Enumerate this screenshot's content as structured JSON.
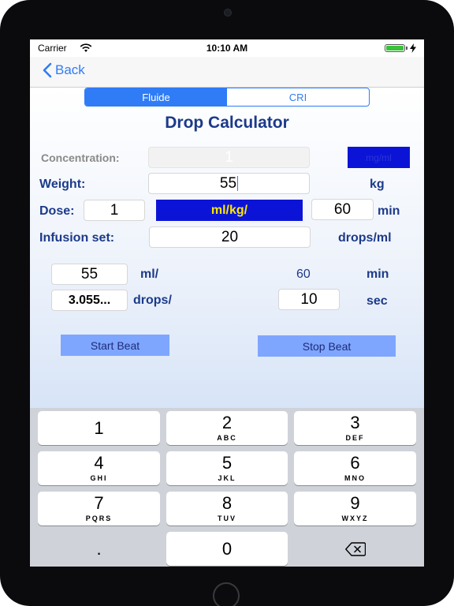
{
  "status_bar": {
    "carrier": "Carrier",
    "time": "10:10 AM"
  },
  "nav": {
    "back_label": "Back"
  },
  "segment": {
    "items": [
      "Fluide",
      "CRI"
    ],
    "selected": "Fluide"
  },
  "title": "Drop Calculator",
  "concentration": {
    "label": "Concentration:",
    "value": "1",
    "unit": "mg/ml"
  },
  "weight": {
    "label": "Weight:",
    "value": "55",
    "unit": "kg"
  },
  "dose": {
    "label": "Dose:",
    "value": "1",
    "unit": "ml/kg/",
    "time_value": "60",
    "time_unit": "min"
  },
  "infusion_set": {
    "label": "Infusion set:",
    "value": "20",
    "unit": "drops/ml"
  },
  "result_volume": {
    "value": "55",
    "unit": "ml/",
    "time_value": "60",
    "time_unit": "min"
  },
  "result_drops": {
    "value": "3.055...",
    "unit": "drops/",
    "time_value": "10",
    "time_unit": "sec"
  },
  "buttons": {
    "start": "Start Beat",
    "stop": "Stop Beat"
  },
  "keyboard": {
    "keys": [
      {
        "num": "1",
        "letters": ""
      },
      {
        "num": "2",
        "letters": "ABC"
      },
      {
        "num": "3",
        "letters": "DEF"
      },
      {
        "num": "4",
        "letters": "GHI"
      },
      {
        "num": "5",
        "letters": "JKL"
      },
      {
        "num": "6",
        "letters": "MNO"
      },
      {
        "num": "7",
        "letters": "PQRS"
      },
      {
        "num": "8",
        "letters": "TUV"
      },
      {
        "num": "9",
        "letters": "WXYZ"
      },
      {
        "num": ".",
        "letters": ""
      },
      {
        "num": "0",
        "letters": ""
      }
    ]
  },
  "colors": {
    "accent": "#2f7cf6",
    "label": "#1c3a8a",
    "unit_box": "#0b14d6",
    "unit_text": "#ffe600",
    "beat_button": "#7ea6ff"
  }
}
